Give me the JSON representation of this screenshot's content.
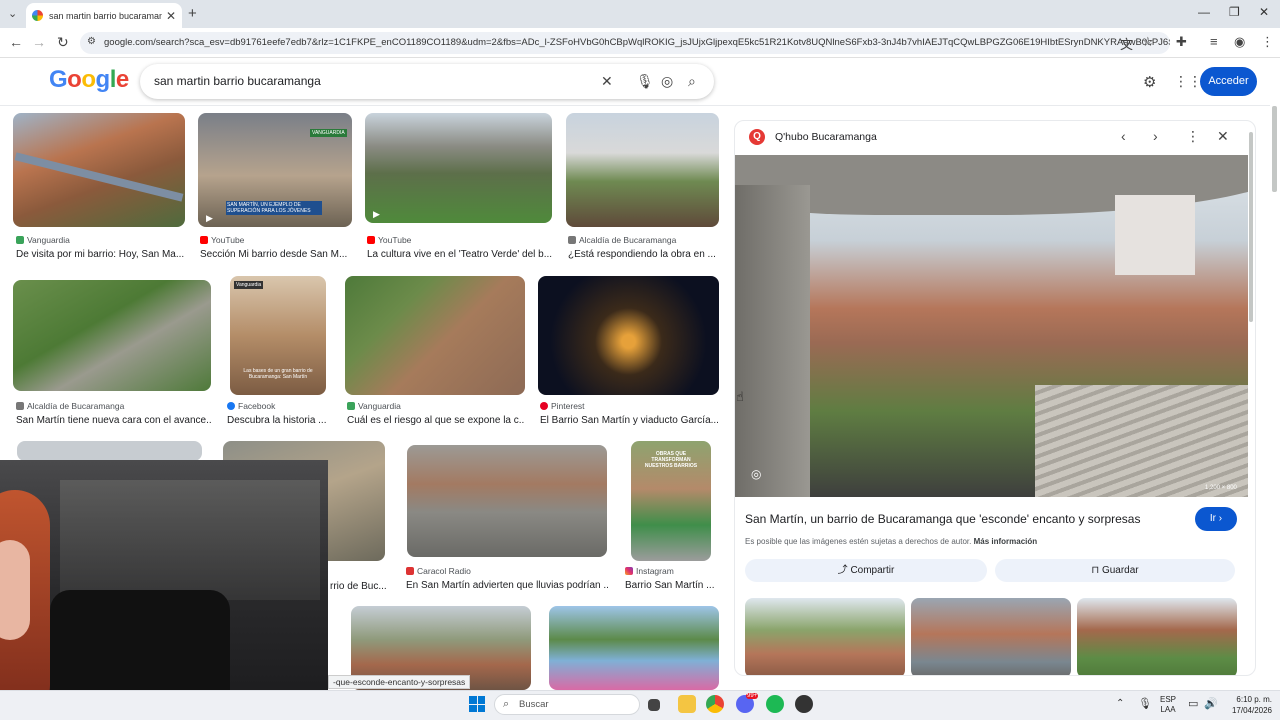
{
  "browser": {
    "tab_title": "san martin barrio bucaramanga",
    "new_tab": "+",
    "url": "google.com/search?sca_esv=db91761eefe7edb7&rlz=1C1FKPE_enCO1189CO1189&udm=2&fbs=ADc_l-ZSFoHVbG0hCBpWqlROKIG_jsJUjxGljpexqE5kc51R21Kotv8UQNlneS6Fxb3-3nJ4b7vhIAEJTqCQwLBPGZG06E19HIbtESrynDNKYRAawB0cPJ6S..."
  },
  "google": {
    "logo": "Google",
    "query": "san martin barrio bucaramanga",
    "login_label": "Acceder"
  },
  "results": [
    {
      "source": "Vanguardia",
      "title": "De visita por mi barrio: Hoy, San Ma..."
    },
    {
      "source": "YouTube",
      "title": "Sección Mi barrio desde San M..."
    },
    {
      "source": "YouTube",
      "title": "La cultura vive en el 'Teatro Verde' del b..."
    },
    {
      "source": "Alcaldía de Bucaramanga",
      "title": "¿Está respondiendo la obra en ..."
    },
    {
      "source": "Alcaldía de Bucaramanga",
      "title": "San Martín tiene nueva cara con el avance..."
    },
    {
      "source": "Facebook",
      "title": "Descubra la historia ..."
    },
    {
      "source": "Vanguardia",
      "title": "Cuál es el riesgo al que se expone la c..."
    },
    {
      "source": "Pinterest",
      "title": "El Barrio San Martín y viaducto García..."
    },
    {
      "source": "",
      "title": "rrio de Buc..."
    },
    {
      "source": "Caracol Radio",
      "title": "En San Martín advierten que lluvias podrían ..."
    },
    {
      "source": "Instagram",
      "title": "Barrio San Martín ..."
    }
  ],
  "thumb_overlays": {
    "facebook_thumb": "Las bases de un gran barrio de Bucaramanga: San Martín",
    "facebook_brand": "Vanguardia",
    "instagram_thumb": "OBRAS QUE TRANSFORMAN NUESTROS BARRIOS",
    "youtube_brand": "VANGUARDIA",
    "youtube_caption": "SAN MARTÍN, UN EJEMPLO DE SUPERACIÓN PARA LOS JÓVENES"
  },
  "panel": {
    "source": "Q'hubo Bucaramanga",
    "dimensions": "1,200 × 800",
    "title": "San Martín, un barrio de Bucaramanga que 'esconde' encanto y sorpresas",
    "visit_label": "Ir",
    "copyright": "Es posible que las imágenes estén sujetas a derechos de autor.",
    "more_info": "Más información",
    "share_label": "Compartir",
    "save_label": "Guardar"
  },
  "status_url": "-que-esconde-encanto-y-sorpresas",
  "taskbar": {
    "search_placeholder": "Buscar",
    "lang": "ESP",
    "lang2": "LAA",
    "time": "6:10 p. m.",
    "date": "17/04/2026",
    "discord_badge": "99+"
  },
  "colors": {
    "accent": "#0b57d0",
    "youtube": "#ff0000",
    "pinterest": "#e60023"
  }
}
